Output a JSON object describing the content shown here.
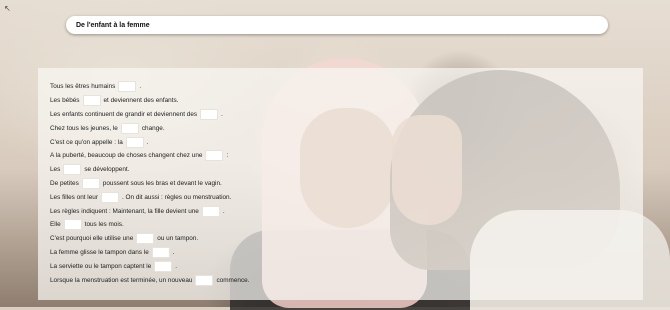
{
  "page": {
    "title": "De l'enfant à la femme",
    "corner_mark": "↖"
  },
  "exercise": {
    "lines": [
      {
        "before": "Tous les êtres humains",
        "after": "."
      },
      {
        "before": "Les bébés",
        "after": "et deviennent des enfants."
      },
      {
        "before": "Les enfants continuent de grandir et deviennent des",
        "after": "."
      },
      {
        "before": "Chez tous les jeunes, le",
        "after": "change."
      },
      {
        "before": "C'est ce qu'on appelle : la",
        "after": "."
      },
      {
        "before": "A la puberté, beaucoup de choses changent chez une",
        "after": ":"
      },
      {
        "before": "Les",
        "after": "se développent."
      },
      {
        "before": "De petites",
        "after": "poussent sous les bras et devant le vagin."
      },
      {
        "before": "Les filles ont leur",
        "after": ". On dit aussi : règles ou menstruation."
      },
      {
        "before": "Les règles indiquent : Maintenant, la fille devient une",
        "after": "."
      },
      {
        "before": "Elle",
        "after": "tous les mois."
      },
      {
        "before": "C'est pourquoi elle utilise une",
        "after": "ou un tampon."
      },
      {
        "before": "La femme glisse le tampon dans le",
        "after": "."
      },
      {
        "before": "La serviette ou le tampon captent le",
        "after": "."
      },
      {
        "before": "Lorsque la menstruation est terminée, un nouveau",
        "after": "commence."
      }
    ],
    "input_placeholder": ""
  }
}
